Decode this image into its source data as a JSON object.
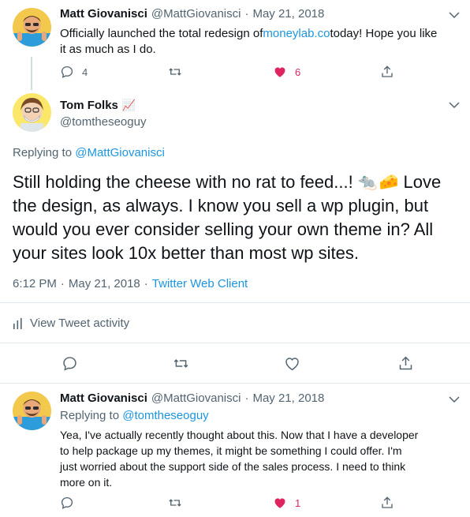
{
  "tweet1": {
    "name": "Matt Giovanisci",
    "handle": "@MattGiovanisci",
    "sep": "·",
    "date": "May 21, 2018",
    "text_before": "Officially launched the total redesign of ",
    "text_link": "moneylab.co",
    "text_after_line1": " today! Hope you like",
    "text_line2": "it as much as I do.",
    "replies": "4",
    "likes": "6"
  },
  "tweet2": {
    "name": "Tom Folks",
    "badge": "📈",
    "handle": "@tomtheseoguy",
    "replying_prefix": "Replying to ",
    "replying_handle": "@MattGiovanisci",
    "text_line1": "Still holding the cheese with no rat to feed...!",
    "emoji_rat": "🐀",
    "emoji_cheese": "🧀",
    "text_line1_end": "Love",
    "text_line2": "the design, as always. I know you sell a wp plugin, but",
    "text_line3": "would you ever consider selling your own theme in? All",
    "text_line4": "your sites look 10x better than most wp sites.",
    "time": "6:12 PM",
    "sep": "·",
    "date": "May 21, 2018",
    "client": "Twitter Web Client",
    "activity_label": "View Tweet activity"
  },
  "tweet3": {
    "name": "Matt Giovanisci",
    "handle": "@MattGiovanisci",
    "sep": "·",
    "date": "May 21, 2018",
    "replying_prefix": "Replying to ",
    "replying_handle": "@tomtheseoguy",
    "text_line1": "Yea, I've actually recently thought about this. Now that I have a developer",
    "text_line2": "to help package up my themes, it might be something I could offer. I'm",
    "text_line3": "just worried about the support side of the sales process. I need to think",
    "text_line4": "more on it.",
    "likes": "1"
  },
  "colors": {
    "like_red": "#e0245e",
    "link_blue": "#1b95e0",
    "muted_gray": "#536471"
  }
}
